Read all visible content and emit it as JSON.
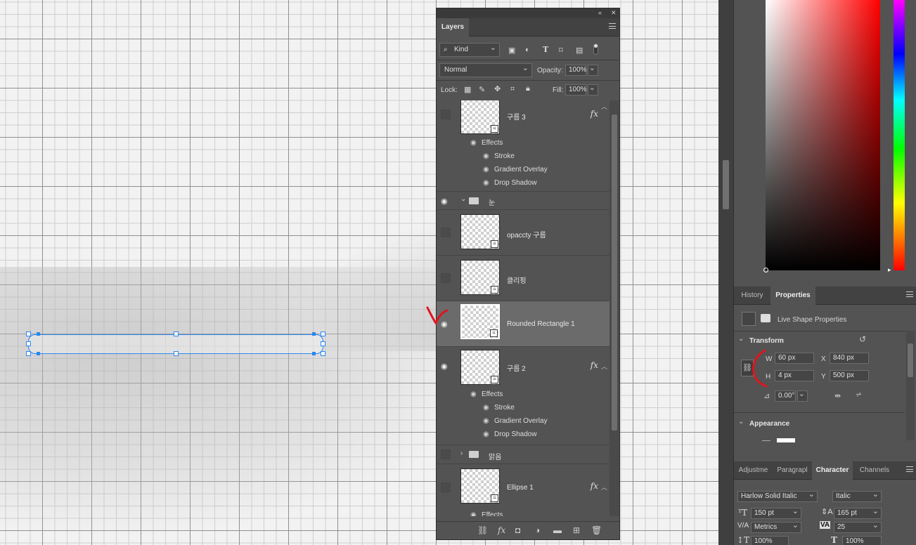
{
  "layers_panel": {
    "title": "Layers",
    "filter_kind": "Kind",
    "blend_mode": "Normal",
    "opacity_label": "Opacity:",
    "opacity_value": "100%",
    "lock_label": "Lock:",
    "fill_label": "Fill:",
    "fill_value": "100%",
    "layers": [
      {
        "name": "구름 3",
        "has_fx": true,
        "visible": false
      },
      {
        "name": "눈",
        "type": "group",
        "visible": true
      },
      {
        "name": "opaccty 구름",
        "visible": false
      },
      {
        "name": "클리핑",
        "visible": false
      },
      {
        "name": "Rounded Rectangle 1",
        "visible": true,
        "selected": true
      },
      {
        "name": "구름 2",
        "has_fx": true,
        "visible": true
      },
      {
        "name": "맑음",
        "type": "group",
        "visible": false
      },
      {
        "name": "Ellipse 1",
        "has_fx": true,
        "visible": false
      }
    ],
    "effects_label": "Effects",
    "effect_stroke": "Stroke",
    "effect_gradient": "Gradient Overlay",
    "effect_shadow": "Drop Shadow",
    "fx_symbol": "fx"
  },
  "properties_panel": {
    "tab_history": "History",
    "tab_properties": "Properties",
    "live_shape_label": "Live Shape Properties",
    "transform_title": "Transform",
    "w_label": "W",
    "w_value": "60 px",
    "h_label": "H",
    "h_value": "4 px",
    "x_label": "X",
    "x_value": "840 px",
    "y_label": "Y",
    "y_value": "500 px",
    "angle_value": "0.00°",
    "appearance_title": "Appearance"
  },
  "character_panel": {
    "tab_adjustments": "Adjustme",
    "tab_paragraph": "Paragrapl",
    "tab_character": "Character",
    "tab_channels": "Channels",
    "font_family": "Harlow Solid Italic",
    "font_style": "Italic",
    "font_size": "150 pt",
    "leading": "165 pt",
    "kerning": "Metrics",
    "tracking": "25",
    "vertical_scale": "100%",
    "horizontal_scale": "100%"
  },
  "colors": {
    "accent": "#2b87f0",
    "annotation": "#e0141e",
    "panel_bg": "#535353"
  }
}
